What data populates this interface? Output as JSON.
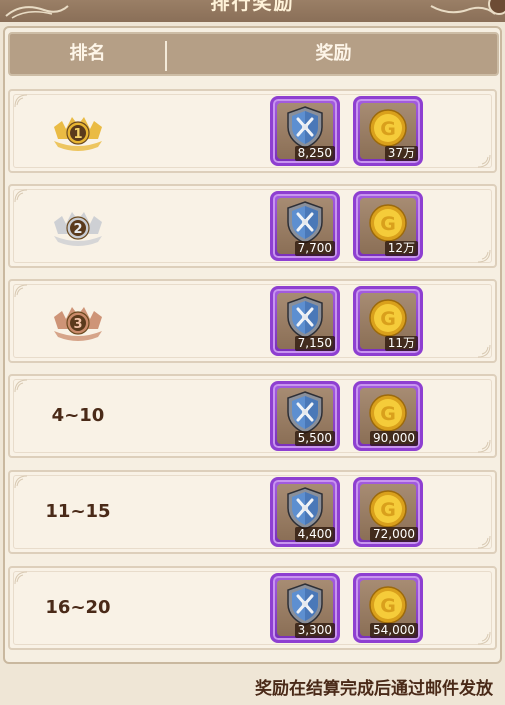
{
  "title": "排行奖励",
  "header": {
    "rank_label": "排名",
    "reward_label": "奖励"
  },
  "rows": [
    {
      "rank": "1",
      "badge": "gold-medal",
      "rewards": [
        {
          "icon": "shield-icon",
          "qty": "8,250"
        },
        {
          "icon": "gold-coin-icon",
          "qty": "37万"
        }
      ]
    },
    {
      "rank": "2",
      "badge": "silver-medal",
      "rewards": [
        {
          "icon": "shield-icon",
          "qty": "7,700"
        },
        {
          "icon": "gold-coin-icon",
          "qty": "12万"
        }
      ]
    },
    {
      "rank": "3",
      "badge": "bronze-medal",
      "rewards": [
        {
          "icon": "shield-icon",
          "qty": "7,150"
        },
        {
          "icon": "gold-coin-icon",
          "qty": "11万"
        }
      ]
    },
    {
      "rank": "4~10",
      "rewards": [
        {
          "icon": "shield-icon",
          "qty": "5,500"
        },
        {
          "icon": "gold-coin-icon",
          "qty": "90,000"
        }
      ]
    },
    {
      "rank": "11~15",
      "rewards": [
        {
          "icon": "shield-icon",
          "qty": "4,400"
        },
        {
          "icon": "gold-coin-icon",
          "qty": "72,000"
        }
      ]
    },
    {
      "rank": "16~20",
      "rewards": [
        {
          "icon": "shield-icon",
          "qty": "3,300"
        },
        {
          "icon": "gold-coin-icon",
          "qty": "54,000"
        }
      ]
    }
  ],
  "footer": "奖励在结算完成后通过邮件发放",
  "colors": {
    "gold": "#e8b532",
    "silver": "#c9ccd2",
    "bronze": "#c98a6a",
    "item_border": "#8e3fd1",
    "text": "#4a2a18"
  }
}
